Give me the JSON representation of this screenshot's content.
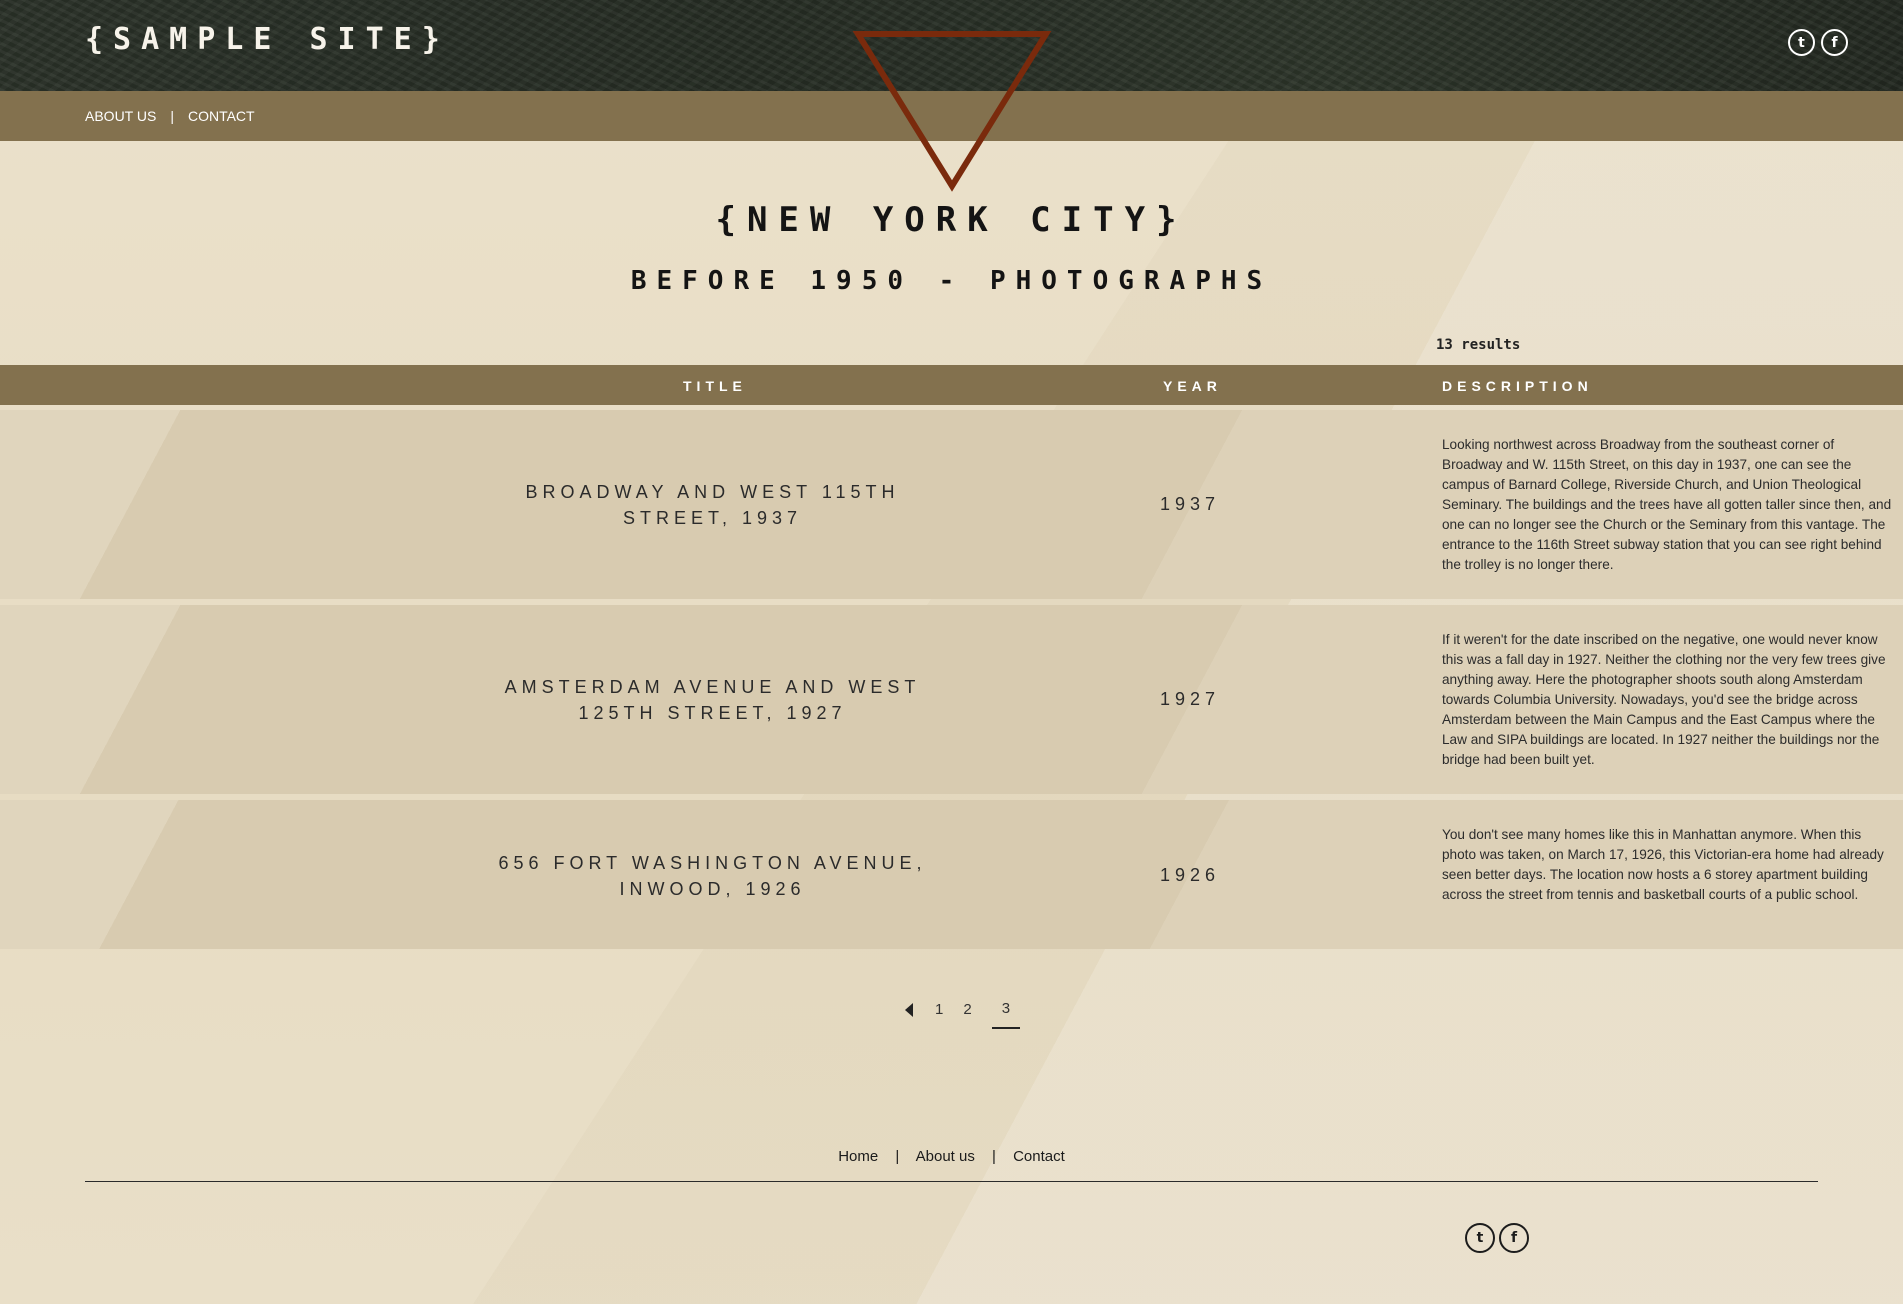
{
  "site": {
    "logo": "{SAMPLE SITE}"
  },
  "nav": {
    "about": "ABOUT US",
    "separator": "|",
    "contact": "CONTACT"
  },
  "social": {
    "twitter_icon": "twitter-icon",
    "facebook_icon": "facebook-icon"
  },
  "heading": {
    "title": "{NEW YORK CITY}",
    "subtitle": "BEFORE 1950 - PHOTOGRAPHS"
  },
  "results": "13 results",
  "table": {
    "headers": {
      "title": "TITLE",
      "year": "YEAR",
      "description": "DESCRIPTION"
    },
    "rows": [
      {
        "title": "BROADWAY AND WEST 115TH STREET, 1937",
        "year": "1937",
        "description": "Looking northwest across Broadway from the southeast corner of Broadway and W. 115th Street, on this day in 1937, one can see the campus of Barnard College, Riverside Church, and Union Theological Seminary. The buildings and the trees have all gotten taller since then, and one can no longer see the Church or the Seminary from this vantage. The entrance to the 116th Street subway station that you can see right behind the trolley is no longer there."
      },
      {
        "title": "AMSTERDAM AVENUE AND WEST 125TH STREET, 1927",
        "year": "1927",
        "description": "If it weren't for the date inscribed on the negative, one would never know this was a fall day in 1927. Neither the clothing nor the very few trees give anything away. Here the photographer shoots south along Amsterdam towards Columbia University. Nowadays, you'd see the bridge across Amsterdam between the Main Campus and the East Campus where the Law and SIPA buildings are located. In 1927 neither the buildings nor the bridge had been built yet."
      },
      {
        "title": "656 FORT WASHINGTON AVENUE, INWOOD, 1926",
        "year": "1926",
        "description": "You don't see many homes like this in Manhattan anymore. When this photo was taken, on March 17, 1926, this Victorian-era home had already seen better days. The location now hosts a 6 storey apartment building across the street from tennis and basketball courts of a public school."
      }
    ]
  },
  "pagination": {
    "pages": [
      "1",
      "2",
      "3"
    ],
    "current": "3"
  },
  "footer": {
    "home": "Home",
    "about": "About us",
    "contact": "Contact",
    "separator": "|"
  },
  "colors": {
    "nav_bg": "#83714e",
    "triangle": "#7a2a0c"
  }
}
